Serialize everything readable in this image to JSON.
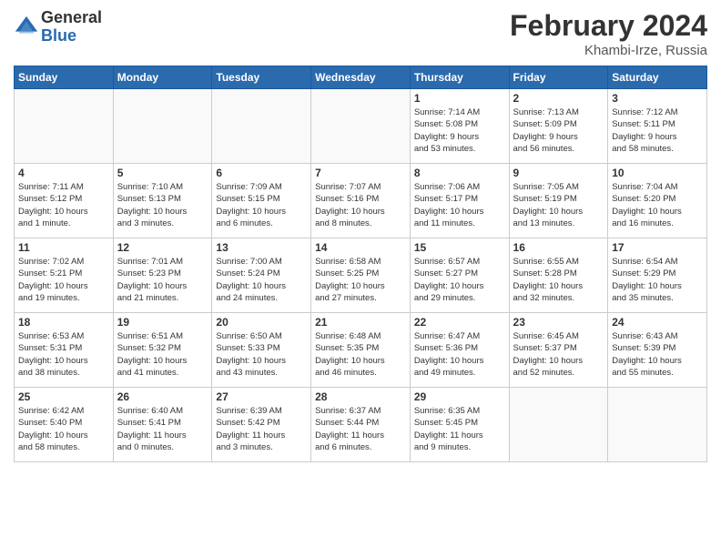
{
  "logo": {
    "general": "General",
    "blue": "Blue"
  },
  "header": {
    "month": "February 2024",
    "location": "Khambi-Irze, Russia"
  },
  "days_of_week": [
    "Sunday",
    "Monday",
    "Tuesday",
    "Wednesday",
    "Thursday",
    "Friday",
    "Saturday"
  ],
  "weeks": [
    [
      {
        "day": "",
        "info": ""
      },
      {
        "day": "",
        "info": ""
      },
      {
        "day": "",
        "info": ""
      },
      {
        "day": "",
        "info": ""
      },
      {
        "day": "1",
        "info": "Sunrise: 7:14 AM\nSunset: 5:08 PM\nDaylight: 9 hours\nand 53 minutes."
      },
      {
        "day": "2",
        "info": "Sunrise: 7:13 AM\nSunset: 5:09 PM\nDaylight: 9 hours\nand 56 minutes."
      },
      {
        "day": "3",
        "info": "Sunrise: 7:12 AM\nSunset: 5:11 PM\nDaylight: 9 hours\nand 58 minutes."
      }
    ],
    [
      {
        "day": "4",
        "info": "Sunrise: 7:11 AM\nSunset: 5:12 PM\nDaylight: 10 hours\nand 1 minute."
      },
      {
        "day": "5",
        "info": "Sunrise: 7:10 AM\nSunset: 5:13 PM\nDaylight: 10 hours\nand 3 minutes."
      },
      {
        "day": "6",
        "info": "Sunrise: 7:09 AM\nSunset: 5:15 PM\nDaylight: 10 hours\nand 6 minutes."
      },
      {
        "day": "7",
        "info": "Sunrise: 7:07 AM\nSunset: 5:16 PM\nDaylight: 10 hours\nand 8 minutes."
      },
      {
        "day": "8",
        "info": "Sunrise: 7:06 AM\nSunset: 5:17 PM\nDaylight: 10 hours\nand 11 minutes."
      },
      {
        "day": "9",
        "info": "Sunrise: 7:05 AM\nSunset: 5:19 PM\nDaylight: 10 hours\nand 13 minutes."
      },
      {
        "day": "10",
        "info": "Sunrise: 7:04 AM\nSunset: 5:20 PM\nDaylight: 10 hours\nand 16 minutes."
      }
    ],
    [
      {
        "day": "11",
        "info": "Sunrise: 7:02 AM\nSunset: 5:21 PM\nDaylight: 10 hours\nand 19 minutes."
      },
      {
        "day": "12",
        "info": "Sunrise: 7:01 AM\nSunset: 5:23 PM\nDaylight: 10 hours\nand 21 minutes."
      },
      {
        "day": "13",
        "info": "Sunrise: 7:00 AM\nSunset: 5:24 PM\nDaylight: 10 hours\nand 24 minutes."
      },
      {
        "day": "14",
        "info": "Sunrise: 6:58 AM\nSunset: 5:25 PM\nDaylight: 10 hours\nand 27 minutes."
      },
      {
        "day": "15",
        "info": "Sunrise: 6:57 AM\nSunset: 5:27 PM\nDaylight: 10 hours\nand 29 minutes."
      },
      {
        "day": "16",
        "info": "Sunrise: 6:55 AM\nSunset: 5:28 PM\nDaylight: 10 hours\nand 32 minutes."
      },
      {
        "day": "17",
        "info": "Sunrise: 6:54 AM\nSunset: 5:29 PM\nDaylight: 10 hours\nand 35 minutes."
      }
    ],
    [
      {
        "day": "18",
        "info": "Sunrise: 6:53 AM\nSunset: 5:31 PM\nDaylight: 10 hours\nand 38 minutes."
      },
      {
        "day": "19",
        "info": "Sunrise: 6:51 AM\nSunset: 5:32 PM\nDaylight: 10 hours\nand 41 minutes."
      },
      {
        "day": "20",
        "info": "Sunrise: 6:50 AM\nSunset: 5:33 PM\nDaylight: 10 hours\nand 43 minutes."
      },
      {
        "day": "21",
        "info": "Sunrise: 6:48 AM\nSunset: 5:35 PM\nDaylight: 10 hours\nand 46 minutes."
      },
      {
        "day": "22",
        "info": "Sunrise: 6:47 AM\nSunset: 5:36 PM\nDaylight: 10 hours\nand 49 minutes."
      },
      {
        "day": "23",
        "info": "Sunrise: 6:45 AM\nSunset: 5:37 PM\nDaylight: 10 hours\nand 52 minutes."
      },
      {
        "day": "24",
        "info": "Sunrise: 6:43 AM\nSunset: 5:39 PM\nDaylight: 10 hours\nand 55 minutes."
      }
    ],
    [
      {
        "day": "25",
        "info": "Sunrise: 6:42 AM\nSunset: 5:40 PM\nDaylight: 10 hours\nand 58 minutes."
      },
      {
        "day": "26",
        "info": "Sunrise: 6:40 AM\nSunset: 5:41 PM\nDaylight: 11 hours\nand 0 minutes."
      },
      {
        "day": "27",
        "info": "Sunrise: 6:39 AM\nSunset: 5:42 PM\nDaylight: 11 hours\nand 3 minutes."
      },
      {
        "day": "28",
        "info": "Sunrise: 6:37 AM\nSunset: 5:44 PM\nDaylight: 11 hours\nand 6 minutes."
      },
      {
        "day": "29",
        "info": "Sunrise: 6:35 AM\nSunset: 5:45 PM\nDaylight: 11 hours\nand 9 minutes."
      },
      {
        "day": "",
        "info": ""
      },
      {
        "day": "",
        "info": ""
      }
    ]
  ]
}
